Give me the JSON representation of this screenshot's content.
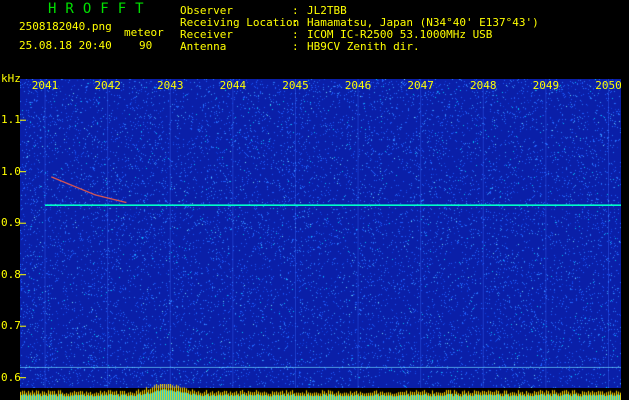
{
  "app": {
    "title": "HROFFT",
    "file": "2508182040.png",
    "datetime": "25.08.18 20:40",
    "mode_label": "meteor",
    "count": "90"
  },
  "station": {
    "labels": [
      "Observer",
      "Receiving Location",
      "Receiver",
      "Antenna"
    ],
    "values": [
      "JL2TBB",
      "Hamamatsu, Japan (N34°40' E137°43')",
      "ICOM IC-R2500 53.1000MHz USB",
      "HB9CV Zenith dir."
    ]
  },
  "chart_data": {
    "type": "heatmap",
    "ylabel": "kHz",
    "x_ticks": [
      "2041",
      "2042",
      "2043",
      "2044",
      "2045",
      "2046",
      "2047",
      "2048",
      "2049",
      "2050"
    ],
    "y_ticks": [
      "1.1",
      "1.0",
      "0.9",
      "0.8",
      "0.7",
      "0.6"
    ],
    "y_range": [
      0.58,
      1.18
    ],
    "carrier_khz": 0.935,
    "meteor_trail": [
      {
        "x": 2041.1,
        "y": 0.99
      },
      {
        "x": 2041.8,
        "y": 0.955
      },
      {
        "x": 2042.3,
        "y": 0.94
      }
    ],
    "colors": {
      "background": "#0a1fa8",
      "noise": "#1e5eff",
      "signal": "#00ffc8",
      "text": "#ffff00",
      "title": "#00e000"
    }
  }
}
